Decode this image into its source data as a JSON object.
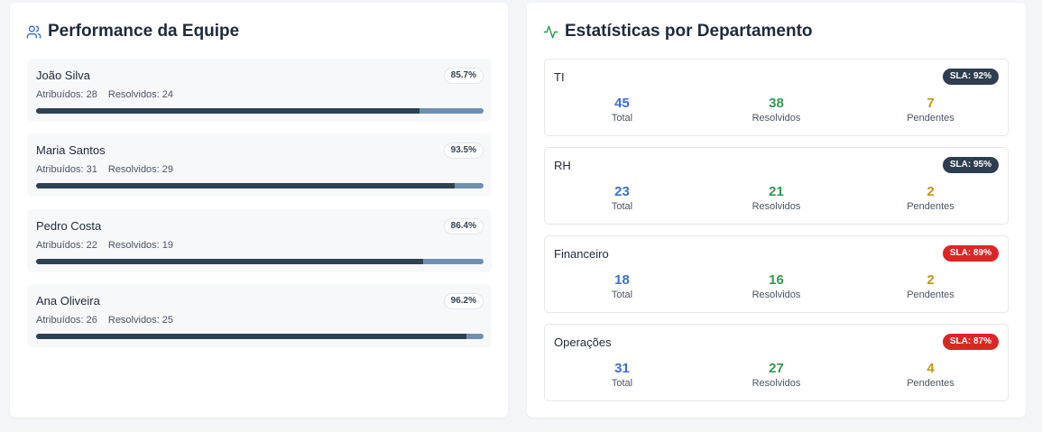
{
  "team": {
    "title": "Performance da Equipe",
    "members": [
      {
        "name": "João Silva",
        "rate": "85.7%",
        "rate_value": 85.7,
        "assigned_label": "Atribuídos: 28",
        "resolved_label": "Resolvidos: 24"
      },
      {
        "name": "Maria Santos",
        "rate": "93.5%",
        "rate_value": 93.5,
        "assigned_label": "Atribuídos: 31",
        "resolved_label": "Resolvidos: 29"
      },
      {
        "name": "Pedro Costa",
        "rate": "86.4%",
        "rate_value": 86.4,
        "assigned_label": "Atribuídos: 22",
        "resolved_label": "Resolvidos: 19"
      },
      {
        "name": "Ana Oliveira",
        "rate": "96.2%",
        "rate_value": 96.2,
        "assigned_label": "Atribuídos: 26",
        "resolved_label": "Resolvidos: 25"
      }
    ]
  },
  "departments": {
    "title": "Estatísticas por Departamento",
    "labels": {
      "total": "Total",
      "resolved": "Resolvidos",
      "pending": "Pendentes"
    },
    "items": [
      {
        "name": "TI",
        "sla": "SLA: 92%",
        "sla_status": "ok",
        "total": "45",
        "resolved": "38",
        "pending": "7"
      },
      {
        "name": "RH",
        "sla": "SLA: 95%",
        "sla_status": "ok",
        "total": "23",
        "resolved": "21",
        "pending": "2"
      },
      {
        "name": "Financeiro",
        "sla": "SLA: 89%",
        "sla_status": "bad",
        "total": "18",
        "resolved": "16",
        "pending": "2"
      },
      {
        "name": "Operações",
        "sla": "SLA: 87%",
        "sla_status": "bad",
        "total": "31",
        "resolved": "27",
        "pending": "4"
      }
    ]
  },
  "colors": {
    "team_icon": "#3b6fd4",
    "activity_icon": "#2f9a4e",
    "bar_fill": "#2e4153",
    "bar_track": "#6f8fb0",
    "sla_ok": "#2e3d4f",
    "sla_bad": "#dc2626"
  }
}
